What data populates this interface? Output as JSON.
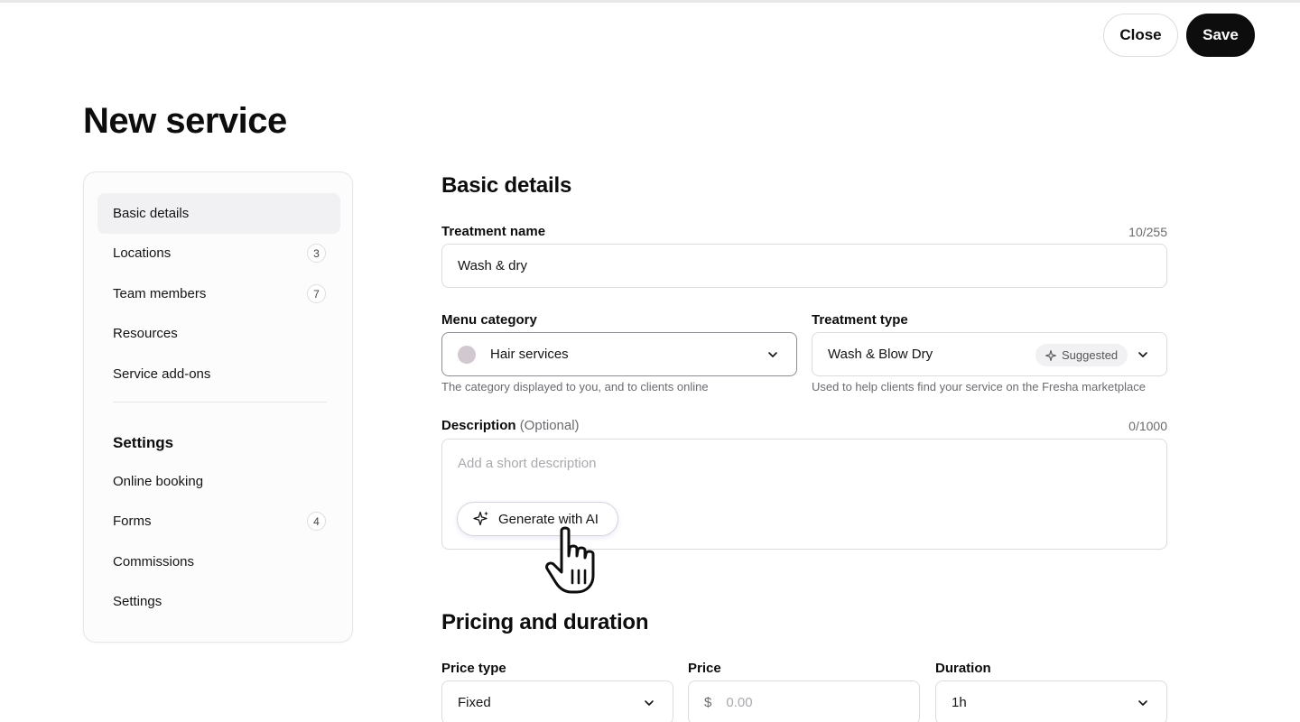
{
  "header": {
    "close_label": "Close",
    "save_label": "Save",
    "page_title": "New service"
  },
  "sidebar": {
    "items": [
      {
        "label": "Basic details",
        "active": true
      },
      {
        "label": "Locations",
        "count": "3"
      },
      {
        "label": "Team members",
        "count": "7"
      },
      {
        "label": "Resources"
      },
      {
        "label": "Service add-ons"
      }
    ],
    "settings_heading": "Settings",
    "settings_items": [
      {
        "label": "Online booking"
      },
      {
        "label": "Forms",
        "count": "4"
      },
      {
        "label": "Commissions"
      },
      {
        "label": "Settings"
      }
    ]
  },
  "basic_details": {
    "title": "Basic details",
    "treatment_name": {
      "label": "Treatment name",
      "counter": "10/255",
      "value": "Wash & dry"
    },
    "menu_category": {
      "label": "Menu category",
      "value": "Hair services",
      "hint": "The category displayed to you, and to clients online",
      "swatch_color": "#d2c8d0"
    },
    "treatment_type": {
      "label": "Treatment type",
      "value": "Wash & Blow Dry",
      "badge": "Suggested",
      "hint": "Used to help clients find your service on the Fresha marketplace"
    },
    "description": {
      "label": "Description",
      "optional": "(Optional)",
      "counter": "0/1000",
      "placeholder": "Add a short description",
      "ai_button": "Generate with AI"
    }
  },
  "pricing": {
    "title": "Pricing and duration",
    "price_type": {
      "label": "Price type",
      "value": "Fixed"
    },
    "price": {
      "label": "Price",
      "currency": "$",
      "placeholder": "0.00"
    },
    "duration": {
      "label": "Duration",
      "value": "1h"
    }
  },
  "colors": {
    "primary": "#0d0d0d",
    "border": "#dcdce0",
    "muted": "#6b6b70"
  }
}
